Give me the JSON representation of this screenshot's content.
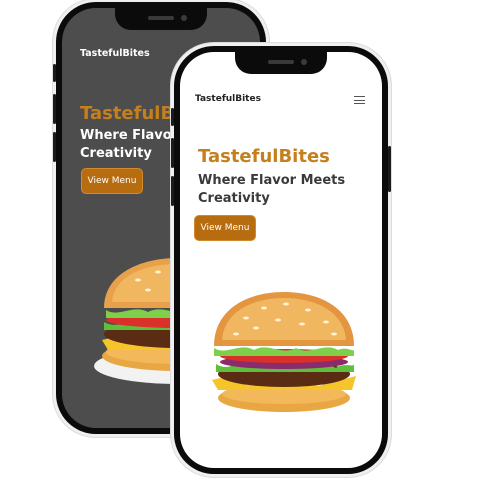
{
  "back_phone": {
    "brand": "TastefulBites",
    "hero_title": "TastefulBites",
    "hero_subtitle_line1": "Where Flavor Meets",
    "hero_subtitle_line2": "Creativity",
    "cta_label": "View Menu"
  },
  "front_phone": {
    "brand": "TastefulBites",
    "menu_icon": "hamburger-menu-icon",
    "hero_title": "TastefulBites",
    "hero_subtitle_line1": "Where Flavor Meets",
    "hero_subtitle_line2": "Creativity",
    "cta_label": "View Menu"
  },
  "colors": {
    "accent": "#c57f1c",
    "button": "#b86c10",
    "back_screen": "#4d4d4d",
    "front_screen": "#ffffff"
  }
}
